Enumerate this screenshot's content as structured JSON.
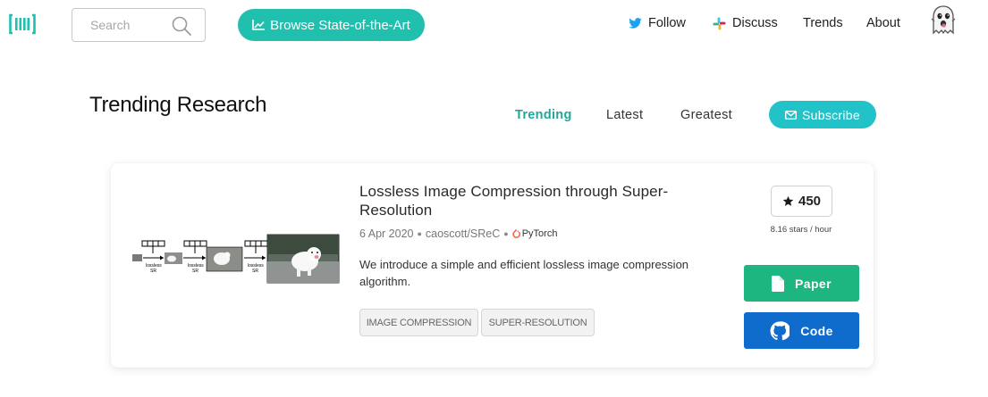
{
  "nav": {
    "search_placeholder": "Search",
    "browse_label": "Browse State-of-the-Art",
    "follow_label": "Follow",
    "discuss_label": "Discuss",
    "trends_label": "Trends",
    "about_label": "About"
  },
  "heading": {
    "title": "Trending Research",
    "tabs": [
      {
        "label": "Trending",
        "active": true
      },
      {
        "label": "Latest",
        "active": false
      },
      {
        "label": "Greatest",
        "active": false
      }
    ],
    "subscribe_label": "Subscribe"
  },
  "paper": {
    "title": "Lossless Image Compression through Super-Resolution",
    "date": "6 Apr 2020",
    "repo": "caoscott/SReC",
    "framework": "PyTorch",
    "abstract": "We introduce a simple and efficient lossless image compression algorithm.",
    "tags": [
      "IMAGE COMPRESSION",
      "SUPER-RESOLUTION"
    ],
    "stars": "450",
    "rate": "8.16 stars / hour",
    "paper_button": "Paper",
    "code_button": "Code",
    "thumb_labels": [
      "lossless",
      "SR"
    ]
  },
  "colors": {
    "brand_teal": "#21bfae",
    "subscribe": "#22c3c8",
    "paper_green": "#1db580",
    "code_blue": "#0f6bcc",
    "active_tab": "#21a89a"
  },
  "icons": [
    "logo-icon",
    "search-icon",
    "chart-icon",
    "twitter-icon",
    "slack-icon",
    "avatar-ghost-icon",
    "envelope-icon",
    "star-icon",
    "pytorch-icon",
    "file-icon",
    "github-icon"
  ]
}
